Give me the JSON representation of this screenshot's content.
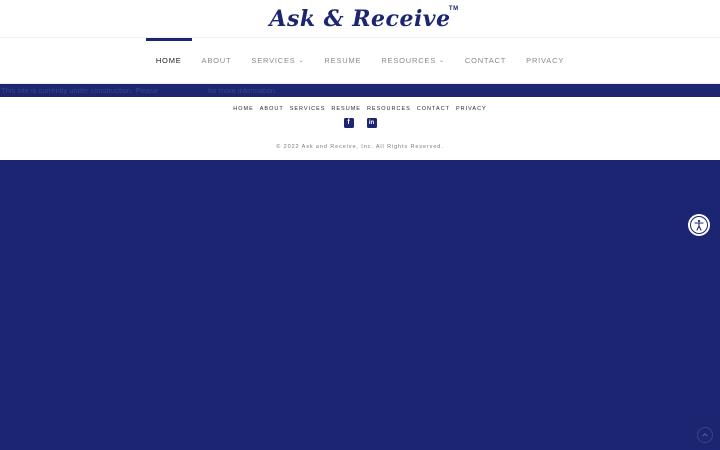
{
  "brand": {
    "name": "Ask & Receive",
    "tm": "TM"
  },
  "nav": {
    "items": [
      {
        "label": "HOME",
        "active": true,
        "dropdown": false
      },
      {
        "label": "ABOUT",
        "active": false,
        "dropdown": false
      },
      {
        "label": "SERVICES",
        "active": false,
        "dropdown": true
      },
      {
        "label": "RESUME",
        "active": false,
        "dropdown": false
      },
      {
        "label": "RESOURCES",
        "active": false,
        "dropdown": true
      },
      {
        "label": "CONTACT",
        "active": false,
        "dropdown": false
      },
      {
        "label": "PRIVACY",
        "active": false,
        "dropdown": false
      }
    ],
    "chevron": "⌄"
  },
  "notice": {
    "part1": "This site is currently under construction. Please",
    "part2": "for more information."
  },
  "footer": {
    "links": [
      "HOME",
      "ABOUT",
      "SERVICES",
      "RESUME",
      "RESOURCES",
      "CONTACT",
      "PRIVACY"
    ],
    "social": [
      {
        "icon": "facebook-square-icon",
        "glyph": "f"
      },
      {
        "icon": "linkedin-icon",
        "glyph": "in"
      }
    ],
    "copyright": "© 2022 Ask and Receive, Inc. All Rights Reserved."
  },
  "colors": {
    "brand_navy": "#1b2572",
    "nav_text": "#8a8a8a",
    "nav_active": "#1e1e1e",
    "background": "#ffffff"
  }
}
